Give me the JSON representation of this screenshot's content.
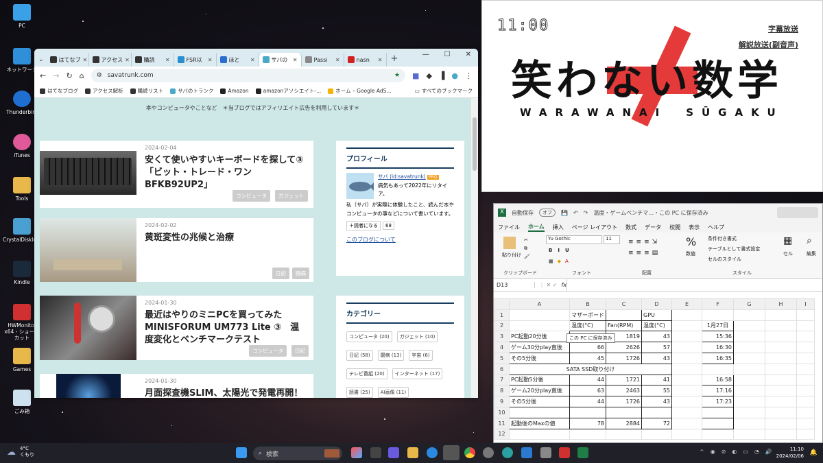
{
  "desktop": {
    "icons": [
      "PC",
      "ネットワーク",
      "Thunderbird",
      "iTunes",
      "Tools",
      "CrystalDiskIn...",
      "Kindle",
      "HWMonitor x64 - ショートカット",
      "Games",
      "ごみ箱"
    ]
  },
  "browser": {
    "tabs": [
      "はてなブ",
      "アクセス",
      "購読",
      "FSR以",
      "ほと",
      "サバの",
      "Passi",
      "nasn"
    ],
    "url": "savatrunk.com",
    "bookmarks": [
      "はてなブログ",
      "アクセス解析",
      "購読リスト",
      "サバのトランク",
      "Amazon",
      "amazonアソシエイト-...",
      "ホーム – Google AdS..."
    ],
    "all_bookmarks": "すべてのブックマーク",
    "notice": "本やコンピュータやことなど　＊当ブログではアフィリエイト広告を利用しています＊",
    "posts": [
      {
        "date": "2024-02-04",
        "title": "安くて使いやすいキーボードを探して③「ビット・トレード・ワン BFKB92UP2」",
        "tags": [
          "コンピュータ",
          "ガジェット"
        ]
      },
      {
        "date": "2024-02-02",
        "title": "黄斑変性の兆候と治療",
        "tags": [
          "日記",
          "闘病"
        ]
      },
      {
        "date": "2024-01-30",
        "title": "最近はやりのミニPCを買ってみた MINISFORUM UM773 Lite ③　温度変化とベンチマークテスト",
        "tags": [
          "コンピュータ",
          "日記"
        ]
      },
      {
        "date": "2024-01-30",
        "title": "月面探査機SLIM、太陽光で発電再開！",
        "tags": []
      }
    ],
    "profile": {
      "heading": "プロフィール",
      "name": "サバ (id:savatrunk)",
      "badge": "PRO",
      "bio1": "病気もあって2022年にリタイア。",
      "bio2": "私（サバ）が実際に体験したこと、読んだ本やコンピュータの事などについて書いています。",
      "reader_button": "読者になる",
      "reader_count": "68",
      "about": "このブログについて"
    },
    "categories": {
      "heading": "カテゴリー",
      "items": [
        "コンピュータ (20)",
        "ガジェット (10)",
        "日記 (58)",
        "闘病 (13)",
        "宇宙 (6)",
        "テレビ番組 (20)",
        "インターネット (17)",
        "読書 (25)",
        "AI画像 (11)"
      ]
    }
  },
  "video": {
    "clock": "11:00",
    "title": "笑わない数学",
    "subtitle": "WARAWANAI　SŪGAKU",
    "links": [
      "字幕放送",
      "解説放送(副音声)"
    ]
  },
  "excel": {
    "autosave": "自動保存",
    "autosave_state": "オフ",
    "filename": "温度・ゲームベンチマ…・この PC に保存済み",
    "menus": [
      "ファイル",
      "ホーム",
      "挿入",
      "ページ レイアウト",
      "数式",
      "データ",
      "校閲",
      "表示",
      "ヘルプ"
    ],
    "ribbon": {
      "paste": "貼り付け",
      "clipboard": "クリップボード",
      "font_name": "Yu Gothic",
      "font_size": "11",
      "font": "フォント",
      "align": "配置",
      "number": "数値",
      "cond": "条件付き書式",
      "table": "テーブルとして書式設定",
      "cellstyle": "セルのスタイル",
      "style": "スタイル",
      "cell": "セル",
      "edit": "編集"
    },
    "namebox": "D13",
    "fx": "fx",
    "tooltip": "この PC に保存済み",
    "cols": [
      "A",
      "B",
      "C",
      "D",
      "E",
      "F",
      "G",
      "H",
      "I"
    ],
    "rows": [
      [
        "",
        "マザーボード",
        "",
        "GPU",
        "",
        "",
        "",
        "",
        ""
      ],
      [
        "",
        "温度(°C)",
        "Fan(RPM)",
        "温度(°C)",
        "",
        "1月27日",
        "",
        "",
        ""
      ],
      [
        "PC起動20分後",
        "",
        "1819",
        "43",
        "",
        "15:36",
        "",
        "",
        ""
      ],
      [
        "ゲーム30分play直後",
        "66",
        "2626",
        "57",
        "",
        "16:30",
        "",
        "",
        ""
      ],
      [
        "その5分後",
        "45",
        "1726",
        "43",
        "",
        "16:35",
        "",
        "",
        ""
      ],
      [
        "SATA SSD取り付け",
        "",
        "",
        "",
        "",
        "",
        "",
        "",
        ""
      ],
      [
        "PC起動5分後",
        "44",
        "1721",
        "41",
        "",
        "16:58",
        "",
        "",
        ""
      ],
      [
        "ゲーム20分play直後",
        "63",
        "2463",
        "55",
        "",
        "17:16",
        "",
        "",
        ""
      ],
      [
        "その5分後",
        "44",
        "1726",
        "43",
        "",
        "17:23",
        "",
        "",
        ""
      ],
      [
        "",
        "",
        "",
        "",
        "",
        "",
        "",
        "",
        ""
      ],
      [
        "起動後のMaxの値",
        "78",
        "2884",
        "72",
        "",
        "",
        "",
        "",
        ""
      ],
      [
        "",
        "",
        "",
        "",
        "",
        "",
        "",
        "",
        ""
      ]
    ]
  },
  "taskbar": {
    "temp": "4°C",
    "weather": "くもり",
    "search": "検索",
    "time": "11:10",
    "date": "2024/02/06"
  }
}
